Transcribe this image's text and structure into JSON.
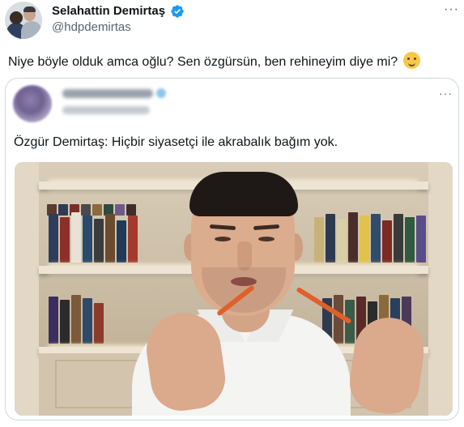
{
  "author": {
    "display_name": "Selahattin Demirtaş",
    "handle": "@hdpdemirtas",
    "verified_icon": "verified-badge-icon",
    "more_icon": "more-options-icon",
    "more_glyph": "···"
  },
  "tweet": {
    "text": "Niye böyle olduk amca oğlu? Sen özgürsün, ben rehineyim diye mi?",
    "emoji": "smiling-face-emoji"
  },
  "quoted_tweet": {
    "author_name": "",
    "author_handle": "",
    "more_glyph": "···",
    "text": "Özgür Demirtaş: Hiçbir siyasetçi ile akrabalık bağım yok.",
    "media": "video-thumbnail-man-with-bookshelf"
  },
  "colors": {
    "text": "#0f1419",
    "secondary": "#536471",
    "verified": "#1d9bf0",
    "border": "#cfd9de"
  }
}
